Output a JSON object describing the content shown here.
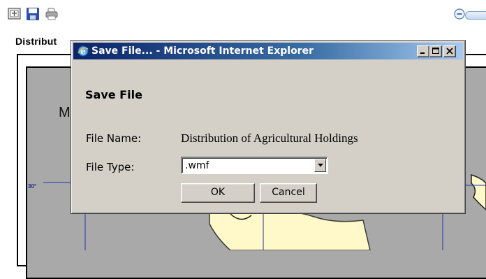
{
  "toolbar": {
    "icons": [
      "map-icon",
      "save-icon",
      "print-icon",
      "zoom-out-icon"
    ]
  },
  "map": {
    "heading": "Distribut",
    "title_letter": "M",
    "lat_label": "30°"
  },
  "dialog": {
    "window_title": "Save File... - Microsoft Internet Explorer",
    "heading": "Save File",
    "file_name_label": "File Name:",
    "file_name_value": "Distribution of Agricultural Holdings",
    "file_type_label": "File Type:",
    "file_type_value": ".wmf",
    "ok_label": "OK",
    "cancel_label": "Cancel",
    "controls": [
      "minimize",
      "maximize",
      "close"
    ]
  },
  "colors": {
    "dialog_bg": "#d4d0c8",
    "titlebar_start": "#0a246a",
    "titlebar_end": "#a6caf0",
    "map_gray": "#a9a9a9",
    "map_region": "#fff8c8",
    "map_lines": "#2233aa"
  }
}
